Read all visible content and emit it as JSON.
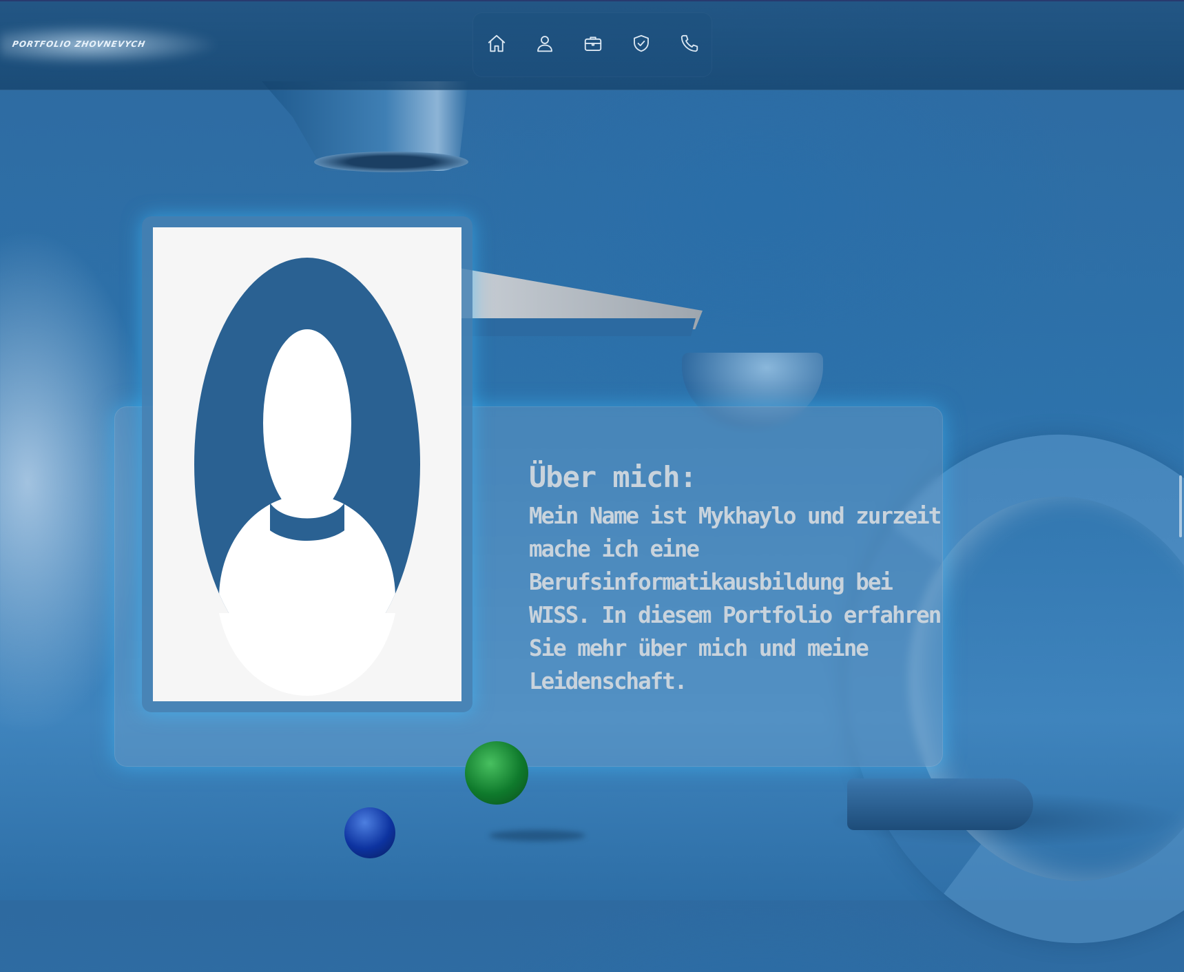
{
  "header": {
    "logo": "PORTFOLIO ZHOVNEVYCH",
    "nav": [
      {
        "icon": "home-icon",
        "label": "Home"
      },
      {
        "icon": "user-icon",
        "label": "About"
      },
      {
        "icon": "briefcase-icon",
        "label": "Projects"
      },
      {
        "icon": "shield-check-icon",
        "label": "Skills"
      },
      {
        "icon": "phone-icon",
        "label": "Contact"
      }
    ]
  },
  "about": {
    "title": "Über mich:",
    "body": "Mein Name ist Mykhaylo und zurzeit mache ich eine Berufsinformatikausbildung bei WISS. In diesem Portfolio erfahren Sie mehr über mich und meine Leidenschaft.",
    "photo_icon": "avatar-placeholder-icon"
  },
  "colors": {
    "background": "#2d6ea6",
    "nav_icon": "#dbe7f2",
    "text": "#c9d3dc",
    "glow": "#3cbeff",
    "avatar": "#2a6192"
  }
}
